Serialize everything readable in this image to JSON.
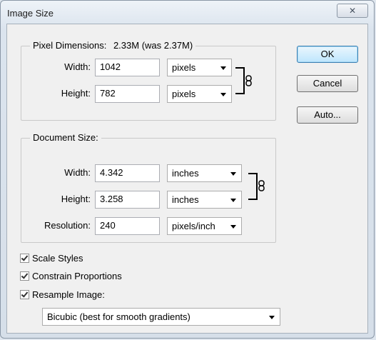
{
  "window": {
    "title": "Image Size",
    "close_symbol": "✕"
  },
  "pixel_dimensions": {
    "title": "Pixel Dimensions:",
    "summary": "2.33M (was 2.37M)",
    "width_label": "Width:",
    "width_value": "1042",
    "width_unit": "pixels",
    "height_label": "Height:",
    "height_value": "782",
    "height_unit": "pixels"
  },
  "document_size": {
    "title": "Document Size:",
    "width_label": "Width:",
    "width_value": "4.342",
    "width_unit": "inches",
    "height_label": "Height:",
    "height_value": "3.258",
    "height_unit": "inches",
    "resolution_label": "Resolution:",
    "resolution_value": "240",
    "resolution_unit": "pixels/inch"
  },
  "buttons": {
    "ok": "OK",
    "cancel": "Cancel",
    "auto": "Auto..."
  },
  "options": {
    "scale_styles": {
      "label": "Scale Styles",
      "checked": true
    },
    "constrain_proportions": {
      "label": "Constrain Proportions",
      "checked": true
    },
    "resample_image": {
      "label": "Resample Image:",
      "checked": true
    },
    "resample_method": "Bicubic (best for smooth gradients)"
  },
  "icons": {
    "link": "chain-link-icon",
    "dropdown": "chevron-down-icon",
    "check": "checkmark-icon"
  }
}
